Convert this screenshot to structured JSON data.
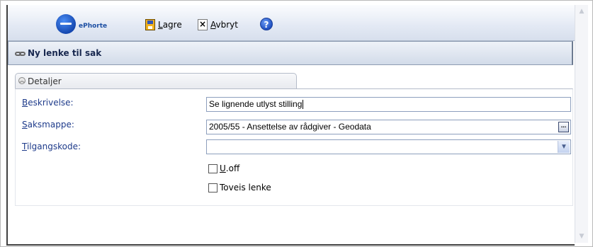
{
  "toolbar": {
    "brand": "ePhorte",
    "save_label": "Lagre",
    "save_accesskey": "L",
    "save_rest": "agre",
    "cancel_label": "Avbryt",
    "cancel_accesskey": "A",
    "cancel_rest": "vbryt",
    "help_glyph": "?"
  },
  "title": {
    "text": "Ny lenke til sak"
  },
  "section": {
    "tab_label": "Detaljer"
  },
  "form": {
    "beskrivelse": {
      "label": "Beskrivelse:",
      "value": "Se lignende utlyst stilling"
    },
    "saksmappe": {
      "label": "Saksmappe:",
      "value": "2005/55 - Ansettelse av rådgiver - Geodata",
      "button_glyph": "..."
    },
    "tilgangskode": {
      "label": "Tilgangskode:",
      "value": ""
    },
    "uoff": {
      "label": "U.off",
      "checked": false
    },
    "toveis": {
      "label": "Toveis lenke",
      "checked": false
    }
  }
}
